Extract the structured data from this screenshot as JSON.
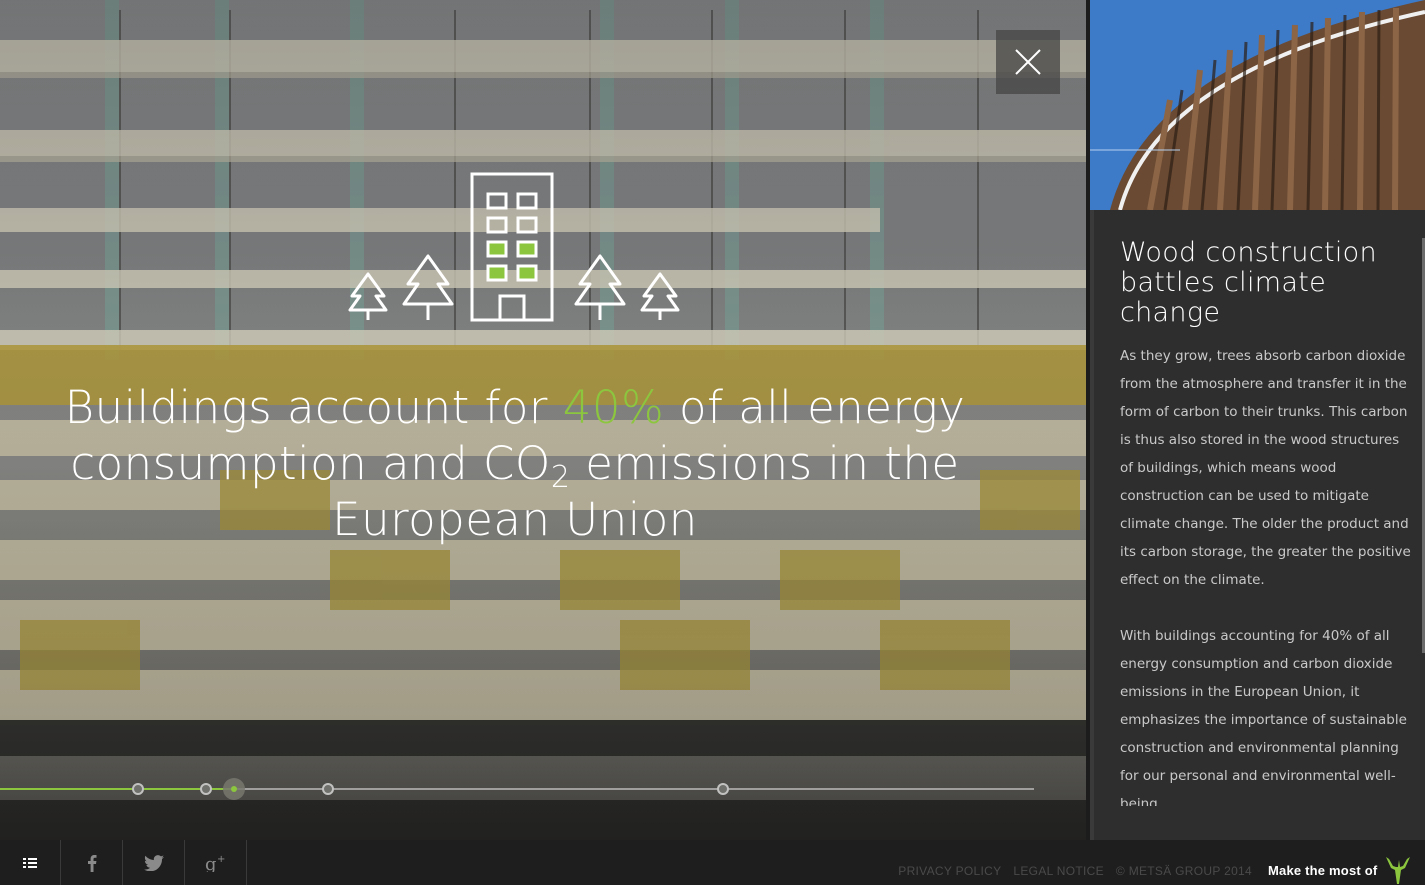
{
  "headline": {
    "part1": "Buildings account for ",
    "highlight": "40%",
    "part2": " of all energy consumption and CO",
    "subscript": "2",
    "part3": " emissions in the European Union"
  },
  "article": {
    "title": "Wood construction battles climate change",
    "paragraphs": [
      "As they grow, trees absorb carbon dioxide from the atmosphere and transfer it in the form of carbon to their trunks. This carbon is thus also stored in the wood structures of buildings, which means wood construction can be used to mitigate climate change. The older the product and its carbon storage, the greater the positive effect on the climate.",
      "With buildings accounting for 40% of all energy consumption and carbon dioxide emissions in the European Union, it emphasizes the importance of sustainable construction and environmental planning for our personal and environmental well-being."
    ]
  },
  "timeline": {
    "progress_percent": 23
  },
  "footer": {
    "links": [
      "PRIVACY POLICY",
      "LEGAL NOTICE"
    ],
    "copyright": "© METSÄ GROUP 2014",
    "brand_text": "Make the most of",
    "buttons": [
      "menu-icon",
      "facebook-icon",
      "twitter-icon",
      "google-plus-icon"
    ]
  },
  "icons": {
    "close": "close-icon",
    "building": "building-icon",
    "tree": "tree-icon",
    "logo": "metsa-logo"
  },
  "colors": {
    "accent_green": "#8cc63f",
    "panel_bg": "#2e2e2e",
    "footer_bg": "#1e1e1e"
  }
}
